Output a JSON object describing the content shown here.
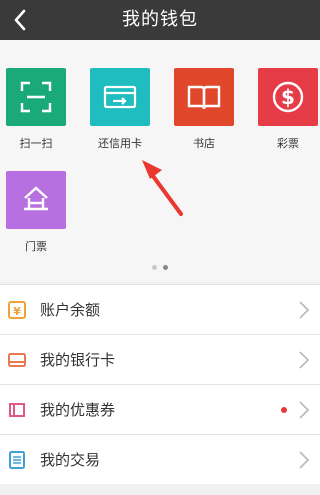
{
  "header": {
    "title": "我的钱包"
  },
  "apps": [
    {
      "label": "扫一扫",
      "icon": "scan-icon",
      "color": "#1aaa7a"
    },
    {
      "label": "还信用卡",
      "icon": "credit-card-repay-icon",
      "color": "#1fbcc0"
    },
    {
      "label": "书店",
      "icon": "book-icon",
      "color": "#e0472b"
    },
    {
      "label": "彩票",
      "icon": "lottery-dollar-icon",
      "color": "#e63c48"
    },
    {
      "label": "门票",
      "icon": "ticket-gate-icon",
      "color": "#b86fe0"
    }
  ],
  "pager": {
    "pages": 2,
    "active": 2
  },
  "menu": [
    {
      "label": "账户余额",
      "icon": "balance-icon",
      "color": "#f0a23a",
      "badge": false
    },
    {
      "label": "我的银行卡",
      "icon": "bank-card-icon",
      "color": "#e8794e",
      "badge": false
    },
    {
      "label": "我的优惠券",
      "icon": "coupon-icon",
      "color": "#e0588a",
      "badge": true
    },
    {
      "label": "我的交易",
      "icon": "transaction-icon",
      "color": "#3fa0d8",
      "badge": false
    }
  ],
  "colors": {
    "header_bg": "#3a3a3a",
    "arrow": "#e8382f",
    "badge": "#e53935"
  }
}
